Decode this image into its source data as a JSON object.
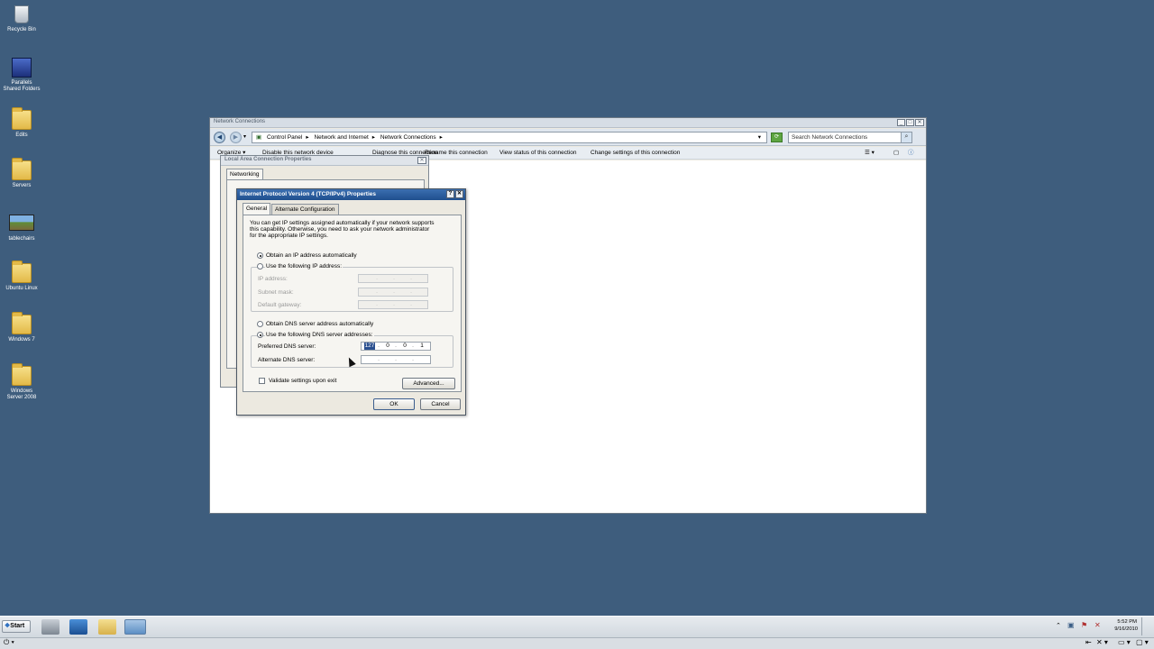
{
  "desktop": {
    "icons": [
      {
        "name": "recycle-bin-icon",
        "label": "Recycle Bin"
      },
      {
        "name": "parallels-shared-folders-icon",
        "label": "Parallels Shared Folders"
      },
      {
        "name": "edits-folder-icon",
        "label": "Edits"
      },
      {
        "name": "servers-folder-icon",
        "label": "Servers"
      },
      {
        "name": "tablechairs-image-icon",
        "label": "tablechairs"
      },
      {
        "name": "ubuntu-linux-folder-icon",
        "label": "Ubuntu Linux"
      },
      {
        "name": "windows-7-folder-icon",
        "label": "Windows 7"
      },
      {
        "name": "windows-server-2008-folder-icon",
        "label": "Windows Server 2008"
      }
    ]
  },
  "explorer": {
    "title": "Network Connections",
    "breadcrumb": [
      "Control Panel",
      "Network and Internet",
      "Network Connections"
    ],
    "search_placeholder": "Search Network Connections",
    "commands": [
      "Organize",
      "Disable this network device",
      "Diagnose this connection",
      "Rename this connection",
      "View status of this connection",
      "Change settings of this connection"
    ]
  },
  "lac_dialog": {
    "title": "Local Area Connection Properties",
    "tab": "Networking"
  },
  "ipv4_dialog": {
    "title": "Internet Protocol Version 4 (TCP/IPv4) Properties",
    "tabs": [
      "General",
      "Alternate Configuration"
    ],
    "intro": [
      "You can get IP settings assigned automatically if your network supports",
      "this capability. Otherwise, you need to ask your network administrator",
      "for the appropriate IP settings."
    ],
    "obtain_ip_auto": "Obtain an IP address automatically",
    "use_following_ip": "Use the following IP address:",
    "ip_address_label": "IP address:",
    "subnet_mask_label": "Subnet mask:",
    "default_gateway_label": "Default gateway:",
    "obtain_dns_auto": "Obtain DNS server address automatically",
    "use_following_dns": "Use the following DNS server addresses:",
    "preferred_dns_label": "Preferred DNS server:",
    "preferred_dns": [
      "127",
      "0",
      "0",
      "1"
    ],
    "alternate_dns_label": "Alternate DNS server:",
    "validate_label": "Validate settings upon exit",
    "advanced_button": "Advanced...",
    "ok_button": "OK",
    "cancel_button": "Cancel"
  },
  "taskbar": {
    "start_label": "Start",
    "time": "5:52 PM",
    "date": "9/16/2010"
  }
}
